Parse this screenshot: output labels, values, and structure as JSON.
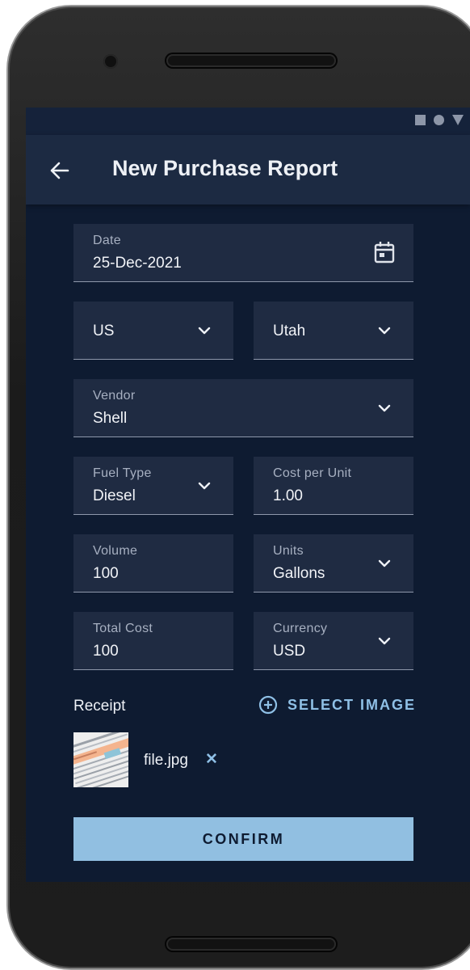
{
  "app": {
    "title": "New Purchase Report"
  },
  "form": {
    "date": {
      "label": "Date",
      "value": "25-Dec-2021"
    },
    "country": {
      "value": "US"
    },
    "state": {
      "value": "Utah"
    },
    "vendor": {
      "label": "Vendor",
      "value": "Shell"
    },
    "fuel_type": {
      "label": "Fuel Type",
      "value": "Diesel"
    },
    "cost_per_unit": {
      "label": "Cost per Unit",
      "value": "1.00"
    },
    "volume": {
      "label": "Volume",
      "value": "100"
    },
    "units": {
      "label": "Units",
      "value": "Gallons"
    },
    "total_cost": {
      "label": "Total Cost",
      "value": "100"
    },
    "currency": {
      "label": "Currency",
      "value": "USD"
    }
  },
  "receipt": {
    "label": "Receipt",
    "select_image_label": "SELECT IMAGE",
    "file_name": "file.jpg",
    "remove_glyph": "✕"
  },
  "confirm_label": "CONFIRM",
  "icons": {
    "back": "arrow-left-icon",
    "calendar": "calendar-icon",
    "dropdown": "chevron-down-icon",
    "add": "plus-circle-icon",
    "remove": "close-icon"
  },
  "colors": {
    "background": "#0e1b31",
    "app_bar": "#1c2a42",
    "field": "#1f2b42",
    "accent": "#91bfe1"
  }
}
